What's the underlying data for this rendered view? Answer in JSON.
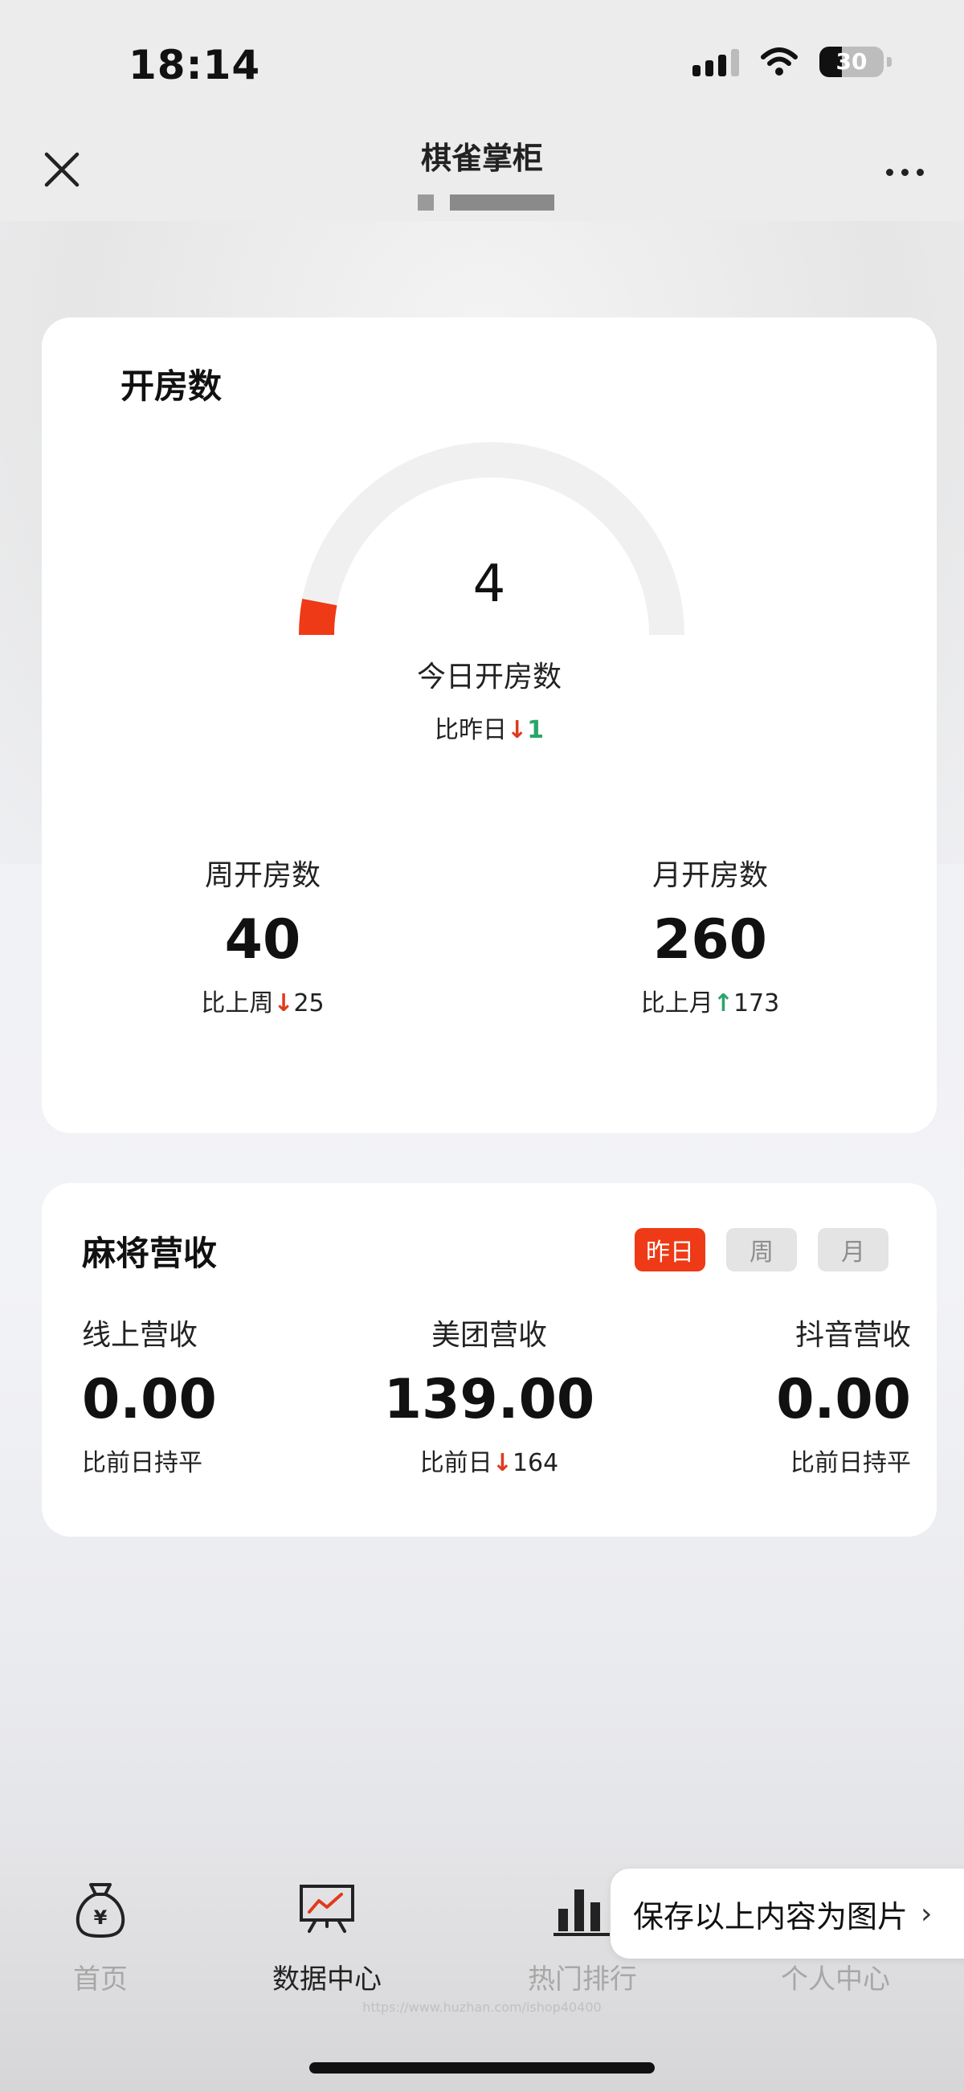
{
  "status_bar": {
    "time": "18:14",
    "battery": "30"
  },
  "nav": {
    "title": "棋雀掌柜"
  },
  "rooms_card": {
    "title": "开房数",
    "gauge": {
      "value": "4",
      "label": "今日开房数",
      "compare_prefix": "比昨日",
      "compare_arrow": "↓",
      "compare_value": "1",
      "fill_fraction": 0.06,
      "fill_color": "#ee3a16"
    },
    "week": {
      "label": "周开房数",
      "value": "40",
      "compare_prefix": "比上周",
      "compare_arrow": "↓",
      "compare_value": "25"
    },
    "month": {
      "label": "月开房数",
      "value": "260",
      "compare_prefix": "比上月",
      "compare_arrow": "↑",
      "compare_value": "173"
    }
  },
  "mahjong_card": {
    "title": "麻将营收",
    "periods": [
      "昨日",
      "周",
      "月"
    ],
    "active_period": "昨日",
    "online": {
      "label": "线上营收",
      "value": "0.00",
      "compare": "比前日持平"
    },
    "meituan": {
      "label": "美团营收",
      "value": "139.00",
      "compare_prefix": "比前日",
      "compare_arrow": "↓",
      "compare_value": "164"
    },
    "douyin": {
      "label": "抖音营收",
      "value": "0.00",
      "compare": "比前日持平"
    }
  },
  "tabbar": {
    "tabs": [
      {
        "label": "首页",
        "icon": "money-bag-icon"
      },
      {
        "label": "数据中心",
        "icon": "chart-board-icon"
      },
      {
        "label": "热门排行",
        "icon": "bar-chart-icon"
      },
      {
        "label": "个人中心",
        "icon": "person-icon"
      }
    ],
    "active_tab": "数据中心"
  },
  "save_popup": {
    "label": "保存以上内容为图片",
    "chevron": "›"
  },
  "watermark": "https://www.huzhan.com/ishop40400"
}
